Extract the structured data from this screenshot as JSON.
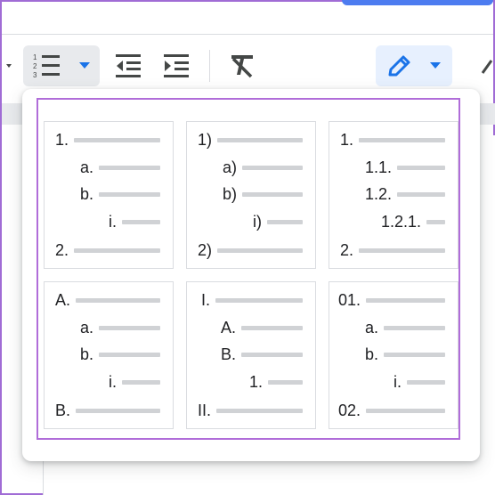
{
  "toolbar": {
    "numbered_list_icon": "numbered-list-icon",
    "dropdown_icon": "triangle-down-icon",
    "outdent_icon": "decrease-indent-icon",
    "indent_icon": "increase-indent-icon",
    "clear_format_icon": "clear-formatting-icon",
    "edit_icon": "pencil-icon"
  },
  "colors": {
    "accent": "#1a73e8",
    "highlight_border": "#b06dd9",
    "list_line": "#d0d2d5",
    "text": "#202124"
  },
  "list_presets": [
    {
      "markers": [
        "1.",
        "a.",
        "b.",
        "i.",
        "2."
      ]
    },
    {
      "markers": [
        "1)",
        "a)",
        "b)",
        "i)",
        "2)"
      ]
    },
    {
      "markers": [
        "1.",
        "1.1.",
        "1.2.",
        "1.2.1.",
        "2."
      ]
    },
    {
      "markers": [
        "A.",
        "a.",
        "b.",
        "i.",
        "B."
      ]
    },
    {
      "markers": [
        "I.",
        "A.",
        "B.",
        "1.",
        "II."
      ]
    },
    {
      "markers": [
        "01.",
        "a.",
        "b.",
        "i.",
        "02."
      ]
    }
  ]
}
